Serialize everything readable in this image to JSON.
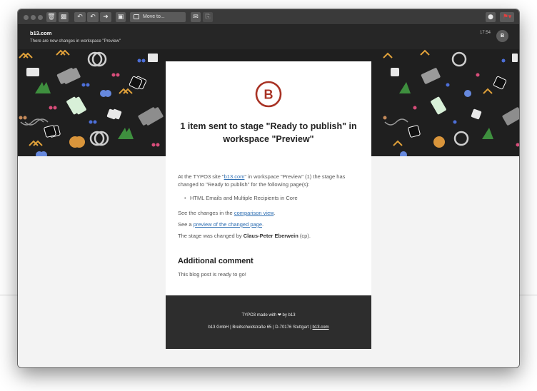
{
  "toolbar": {
    "move_to_label": "Move to...",
    "icons": [
      "trash-icon",
      "archive-icon",
      "reply-icon",
      "reply-all-icon",
      "forward-icon",
      "junk-icon",
      "move-icon",
      "compose-icon",
      "print-icon",
      "chat-icon",
      "flag-icon"
    ]
  },
  "header": {
    "from": "b13.com",
    "subject": "There are new changes in workspace \"Preview\"",
    "time": "17:54",
    "avatar_initial": "B"
  },
  "email": {
    "logo_letter": "B",
    "title": "1 item sent to stage \"Ready to publish\" in workspace \"Preview\"",
    "intro_before": "At the TYPO3 site \"",
    "intro_link": "b13.com",
    "intro_after": "\" in workspace \"Preview\" (1) the stage has changed to \"Ready to publish\" for the following page(s):",
    "pages": [
      "HTML Emails and Multiple Recipients in Core"
    ],
    "comparison_before": "See the changes in the ",
    "comparison_link": "comparison view",
    "comparison_after": ".",
    "preview_before": "See a ",
    "preview_link": "preview of the changed page",
    "preview_after": ".",
    "changed_by_before": "The stage was changed by ",
    "changed_by_name": "Claus-Peter Eberwein",
    "changed_by_after": " (cp).",
    "comment_title": "Additional comment",
    "comment_text": "This blog post is ready to go!"
  },
  "footer": {
    "line1_before": "TYPO3 made with ",
    "heart": "❤",
    "line1_after": " by b13",
    "line2_before": "b13 GmbH | Breitscheidstraße 65 | D-70176 Stuttgart | ",
    "line2_link": "b13.com"
  },
  "colors": {
    "brand": "#a83224",
    "link": "#2f6fb3"
  }
}
